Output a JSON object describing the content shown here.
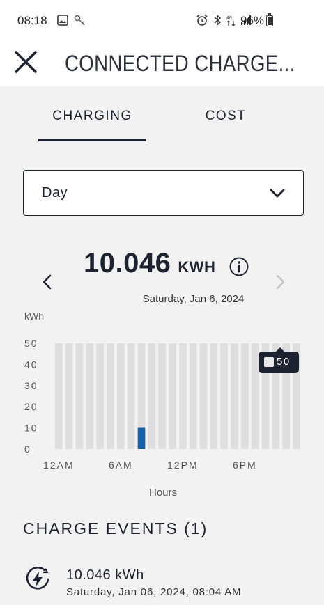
{
  "status_bar": {
    "time": "08:18",
    "battery": "96%",
    "left_icons": [
      "image-icon",
      "key-icon"
    ],
    "right_icons": [
      "alarm-icon",
      "bluetooth-icon",
      "wifi-calling-icon",
      "signal-icon",
      "battery-icon"
    ]
  },
  "header": {
    "title": "CONNECTED CHARGE...",
    "close_icon": "close-icon"
  },
  "tabs": [
    {
      "label": "CHARGING",
      "active": true
    },
    {
      "label": "COST",
      "active": false
    }
  ],
  "period_select": {
    "value": "Day",
    "icon": "chevron-down-icon"
  },
  "summary": {
    "total": "10.046",
    "unit": "KWH",
    "date": "Saturday, Jan 6, 2024",
    "prev_icon": "chevron-left-icon",
    "next_icon": "chevron-right-icon",
    "info_icon": "info-icon"
  },
  "chart_data": {
    "type": "bar",
    "ylabel": "kWh",
    "xlabel": "Hours",
    "ylim": [
      0,
      50
    ],
    "y_ticks": [
      "0",
      "10",
      "20",
      "30",
      "40",
      "50"
    ],
    "x_ticks": [
      "12AM",
      "6AM",
      "12PM",
      "6PM"
    ],
    "categories": [
      "0",
      "1",
      "2",
      "3",
      "4",
      "5",
      "6",
      "7",
      "8",
      "9",
      "10",
      "11",
      "12",
      "13",
      "14",
      "15",
      "16",
      "17",
      "18",
      "19",
      "20",
      "21",
      "22",
      "23"
    ],
    "values": [
      0,
      0,
      0,
      0,
      0,
      0,
      0,
      0,
      10.046,
      0,
      0,
      0,
      0,
      0,
      0,
      0,
      0,
      0,
      0,
      0,
      0,
      0,
      0,
      0
    ],
    "background_max": 50,
    "bar_color": "#1b5fa5",
    "background_color": "#dedede"
  },
  "tooltip": {
    "value": "50"
  },
  "events": {
    "title": "CHARGE EVENTS (1)",
    "items": [
      {
        "energy": "10.046 kWh",
        "datetime": "Saturday, Jan 06, 2024, 08:04 AM",
        "icon": "charging-bolt-icon"
      }
    ]
  }
}
